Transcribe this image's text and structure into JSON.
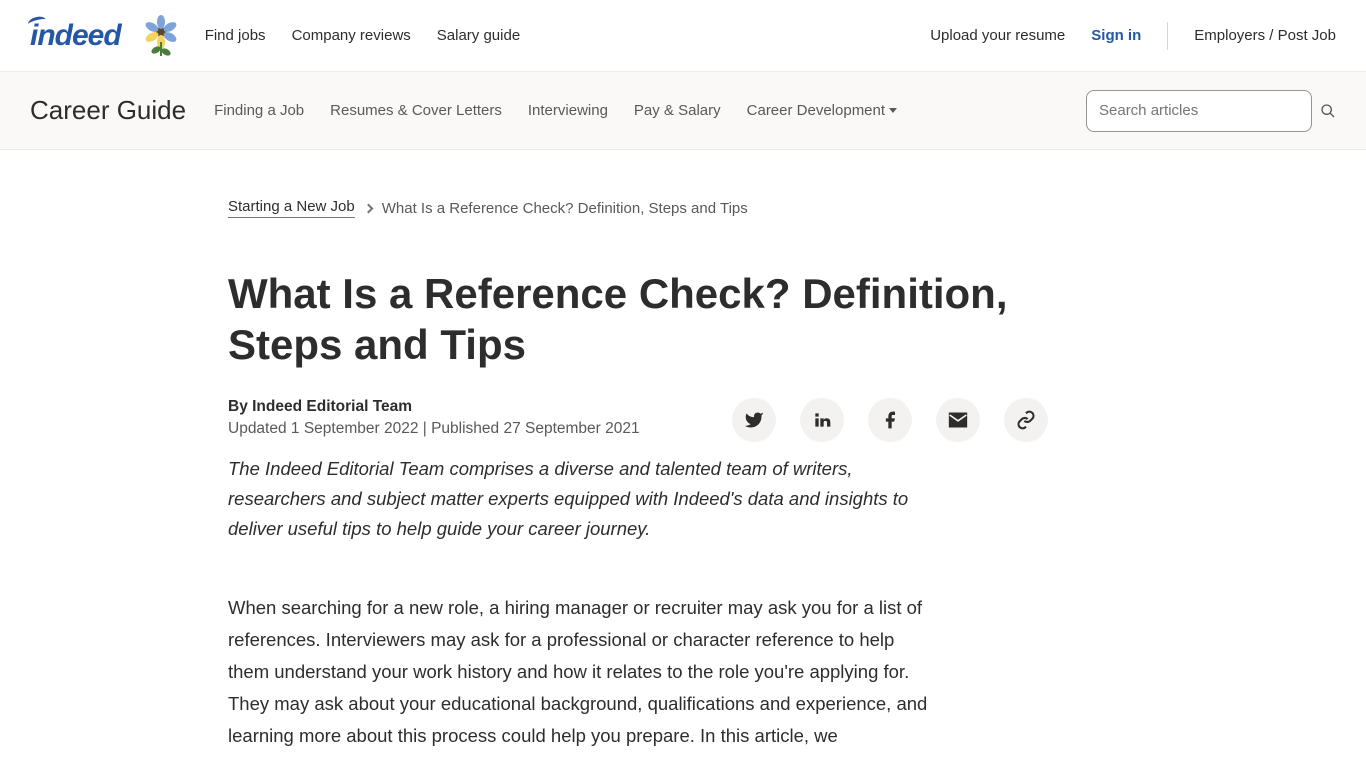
{
  "header": {
    "logo_text": "indeed",
    "nav": [
      "Find jobs",
      "Company reviews",
      "Salary guide"
    ],
    "upload_label": "Upload your resume",
    "signin_label": "Sign in",
    "employers_label": "Employers / Post Job"
  },
  "subnav": {
    "title": "Career Guide",
    "links": [
      "Finding a Job",
      "Resumes & Cover Letters",
      "Interviewing",
      "Pay & Salary",
      "Career Development"
    ],
    "search_placeholder": "Search articles"
  },
  "breadcrumb": {
    "parent": "Starting a New Job",
    "current": "What Is a Reference Check? Definition, Steps and Tips"
  },
  "article": {
    "title": "What Is a Reference Check? Definition, Steps and Tips",
    "author_prefix": "By ",
    "author": "Indeed Editorial Team",
    "dates": "Updated 1 September 2022 | Published 27 September 2021",
    "editorial_note": "The Indeed Editorial Team comprises a diverse and talented team of writers, researchers and subject matter experts equipped with Indeed's data and insights to deliver useful tips to help guide your career journey.",
    "body_para_1": "When searching for a new role, a hiring manager or recruiter may ask you for a list of references. Interviewers may ask for a professional or character reference to help them understand your work history and how it relates to the role you're applying for. They may ask about your educational background, qualifications and experience, and learning more about this process could help you prepare. In this article, we"
  }
}
